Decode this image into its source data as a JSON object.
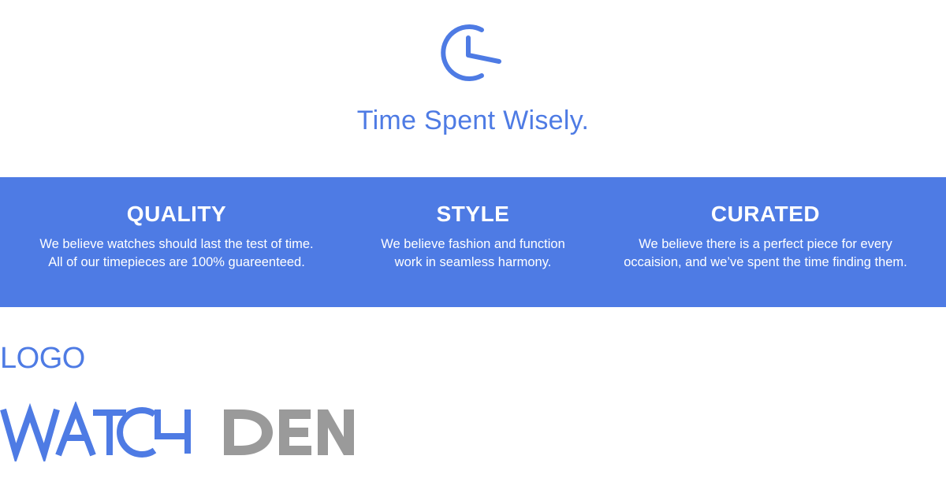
{
  "brand": {
    "tagline": "Time Spent Wisely.",
    "wordmark": "WATCHDEN",
    "primary_color": "#4E7BE4",
    "secondary_color": "#9A9A9A",
    "icon": "clock-c-icon"
  },
  "values": [
    {
      "title": "QUALITY",
      "text": "We believe watches should last the test of time.\nAll of our timepieces are 100% guareenteed."
    },
    {
      "title": "STYLE",
      "text": "We believe fashion and function\nwork in seamless harmony."
    },
    {
      "title": "CURATED",
      "text": "We believe there is a perfect piece for every\noccaision, and we’ve spent the time finding them."
    }
  ],
  "section": {
    "label": "LOGO"
  }
}
